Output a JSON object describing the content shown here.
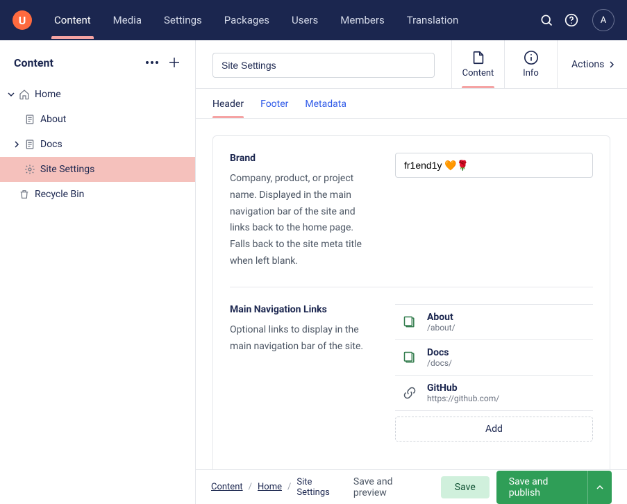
{
  "topnav": {
    "logo_letter": "U",
    "items": [
      "Content",
      "Media",
      "Settings",
      "Packages",
      "Users",
      "Members",
      "Translation"
    ],
    "active_index": 0,
    "avatar_letter": "A"
  },
  "sidebar": {
    "title": "Content",
    "tree": [
      {
        "label": "Home",
        "icon": "home",
        "expanded": true,
        "children": [
          {
            "label": "About",
            "icon": "doc"
          },
          {
            "label": "Docs",
            "icon": "doc",
            "has_children": true
          },
          {
            "label": "Site Settings",
            "icon": "gear",
            "active": true
          }
        ]
      },
      {
        "label": "Recycle Bin",
        "icon": "trash"
      }
    ]
  },
  "editor": {
    "title_value": "Site Settings",
    "tabs": {
      "content_label": "Content",
      "info_label": "Info",
      "actions_label": "Actions"
    },
    "doctabs": [
      "Header",
      "Footer",
      "Metadata"
    ],
    "doctab_active": 0,
    "fields": {
      "brand": {
        "label": "Brand",
        "help": "Company, product, or project name. Displayed in the main navigation bar of the site and links back to the home page. Falls back to the site meta title when left blank.",
        "value": "fr1end1y 🧡🌹"
      },
      "main_nav": {
        "label": "Main Navigation Links",
        "help": "Optional links to display in the main navigation bar of the site.",
        "items": [
          {
            "title": "About",
            "sub": "/about/",
            "kind": "internal"
          },
          {
            "title": "Docs",
            "sub": "/docs/",
            "kind": "internal"
          },
          {
            "title": "GitHub",
            "sub": "https://github.com/",
            "kind": "external"
          }
        ],
        "add_label": "Add"
      }
    }
  },
  "footer": {
    "breadcrumbs": [
      "Content",
      "Home",
      "Site Settings"
    ],
    "save_preview_label": "Save and preview",
    "save_label": "Save",
    "publish_label": "Save and publish"
  },
  "colors": {
    "topnav_bg": "#1b264f",
    "accent_pink": "#f5a3a3",
    "accent_pink_bg": "#f5c1bc",
    "green": "#2f9e57",
    "green_light": "#d0f0dc"
  }
}
